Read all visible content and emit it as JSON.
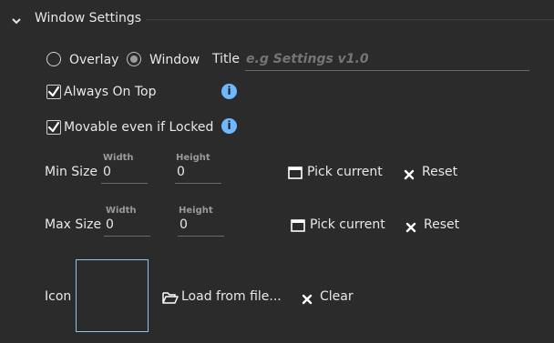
{
  "section": {
    "title": "Window Settings"
  },
  "mode": {
    "overlay_label": "Overlay",
    "window_label": "Window",
    "selected": "Window"
  },
  "title_field": {
    "label": "Title",
    "placeholder": "e.g Settings v1.0",
    "value": ""
  },
  "always_on_top": {
    "label": "Always On Top",
    "checked": true
  },
  "movable_locked": {
    "label": "Movable even if Locked",
    "checked": true
  },
  "min_size": {
    "label": "Min Size",
    "width_label": "Width",
    "width_value": "0",
    "height_label": "Height",
    "height_value": "0",
    "pick_label": "Pick current",
    "reset_label": "Reset"
  },
  "max_size": {
    "label": "Max Size",
    "width_label": "Width",
    "width_value": "0",
    "height_label": "Height",
    "height_value": "0",
    "pick_label": "Pick current",
    "reset_label": "Reset"
  },
  "icon": {
    "label": "Icon",
    "load_label": "Load from file...",
    "clear_label": "Clear"
  },
  "colors": {
    "background": "#2b2b2b",
    "info": "#6fb8ff",
    "icon_border": "#8cc6e8"
  },
  "icons": [
    "chevron-down-icon",
    "info-icon",
    "window-icon",
    "close-icon",
    "folder-open-icon"
  ]
}
